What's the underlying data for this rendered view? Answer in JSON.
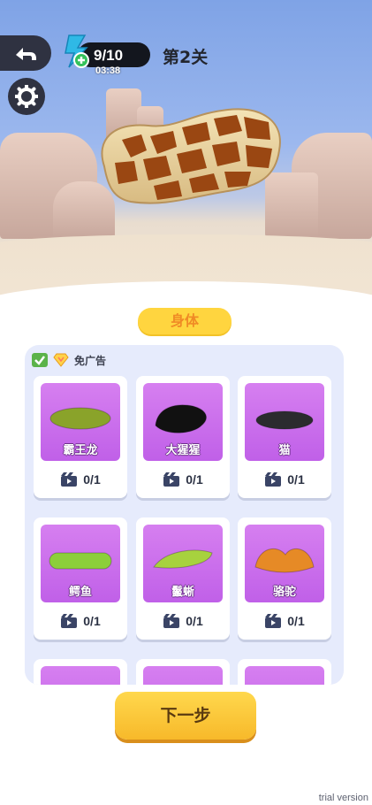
{
  "hud": {
    "energy_count": "9/10",
    "energy_timer": "03:38",
    "level_title": "第2关"
  },
  "category_tab": "身体",
  "ad_free_label": "免广告",
  "cards": [
    {
      "name": "霸王龙",
      "progress": "0/1",
      "color": "#8aa32a"
    },
    {
      "name": "大猩猩",
      "progress": "0/1",
      "color": "#111111"
    },
    {
      "name": "猫",
      "progress": "0/1",
      "color": "#2b2b2e"
    },
    {
      "name": "鳄鱼",
      "progress": "0/1",
      "color": "#8ccf3a"
    },
    {
      "name": "鬣蜥",
      "progress": "0/1",
      "color": "#a7d23e"
    },
    {
      "name": "骆驼",
      "progress": "0/1",
      "color": "#e68a26"
    },
    {
      "name": "",
      "progress": "",
      "color": ""
    },
    {
      "name": "",
      "progress": "",
      "color": ""
    },
    {
      "name": "",
      "progress": "",
      "color": ""
    }
  ],
  "next_button": "下一步",
  "watermark": "trial version",
  "colors": {
    "panel_bg": "#e6ebfc",
    "card_purple": "#c060e8",
    "tab_yellow": "#ffd53f",
    "button_yellow": "#f7b92a"
  }
}
